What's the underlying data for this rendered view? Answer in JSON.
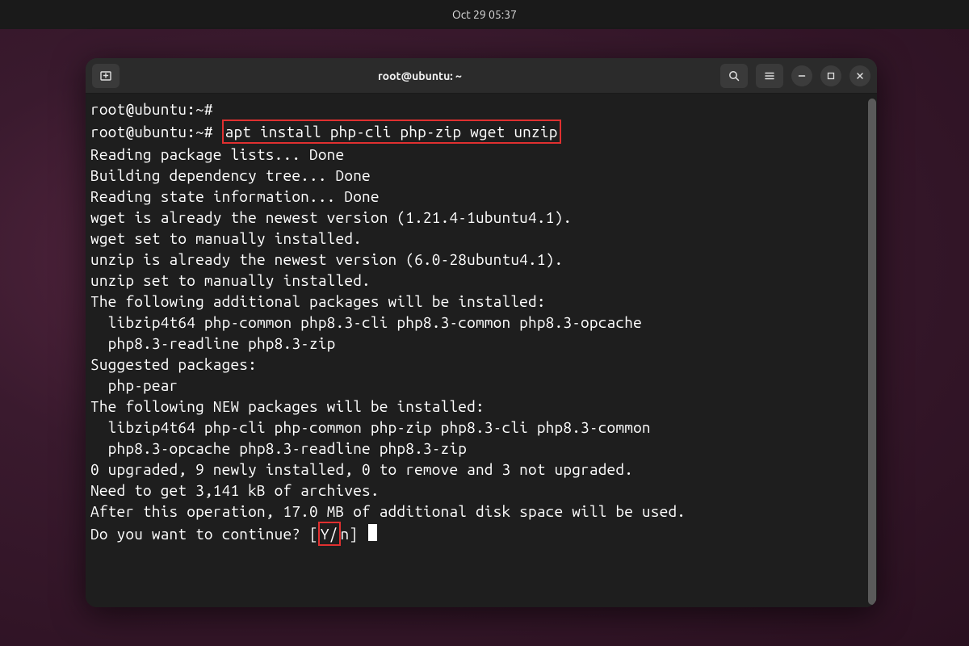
{
  "topbar": {
    "datetime": "Oct 29  05:37"
  },
  "window": {
    "title": "root@ubuntu: ~"
  },
  "terminal": {
    "prompt": "root@ubuntu:~#",
    "command": "apt install php-cli php-zip wget unzip",
    "lines": [
      "Reading package lists... Done",
      "Building dependency tree... Done",
      "Reading state information... Done",
      "wget is already the newest version (1.21.4-1ubuntu4.1).",
      "wget set to manually installed.",
      "unzip is already the newest version (6.0-28ubuntu4.1).",
      "unzip set to manually installed.",
      "The following additional packages will be installed:",
      "  libzip4t64 php-common php8.3-cli php8.3-common php8.3-opcache",
      "  php8.3-readline php8.3-zip",
      "Suggested packages:",
      "  php-pear",
      "The following NEW packages will be installed:",
      "  libzip4t64 php-cli php-common php-zip php8.3-cli php8.3-common",
      "  php8.3-opcache php8.3-readline php8.3-zip",
      "0 upgraded, 9 newly installed, 0 to remove and 3 not upgraded.",
      "Need to get 3,141 kB of archives.",
      "After this operation, 17.0 MB of additional disk space will be used."
    ],
    "continue_prompt_pre": "Do you want to continue? [",
    "continue_y": "Y/",
    "continue_prompt_post": "n] "
  }
}
